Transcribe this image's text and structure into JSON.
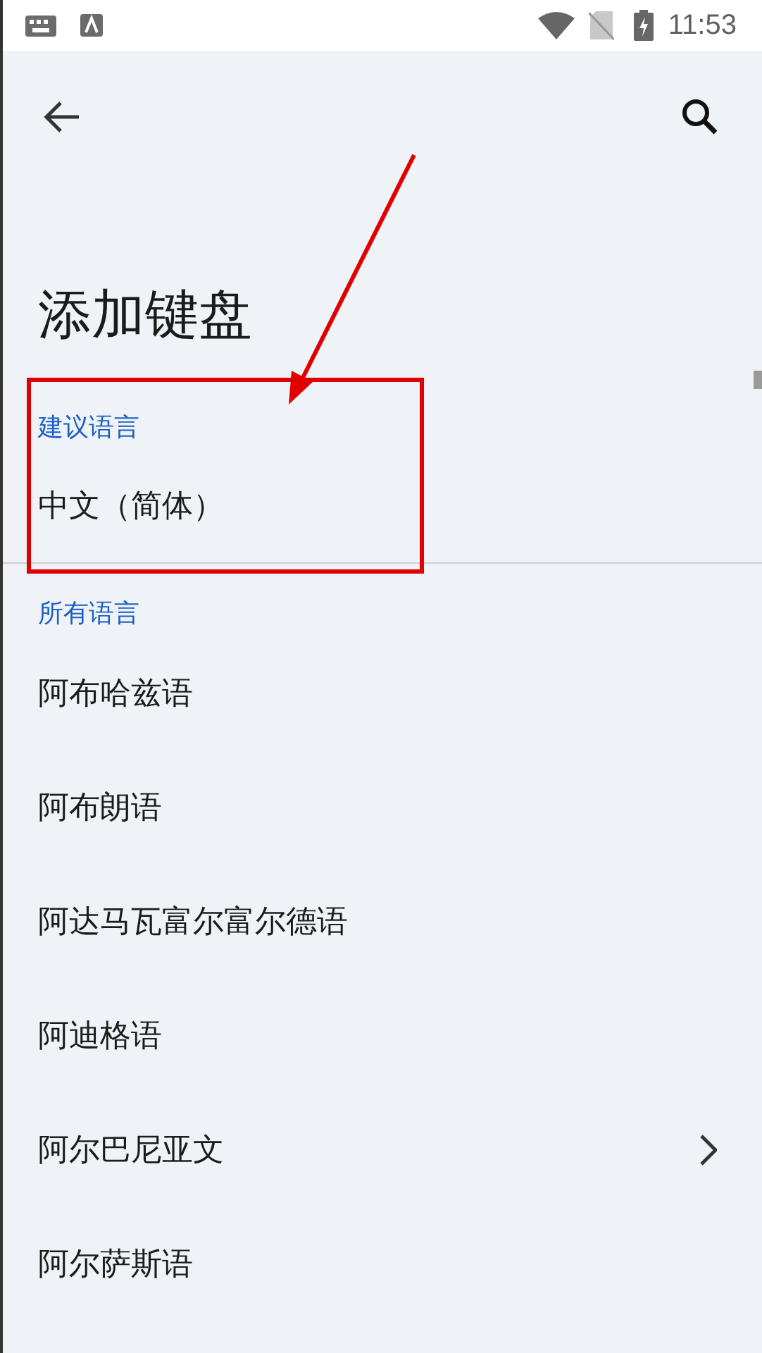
{
  "status_bar": {
    "time": "11:53"
  },
  "title": "添加键盘",
  "sections": [
    {
      "header": "建议语言",
      "items": [
        {
          "label": "中文（简体）",
          "kind": "plain"
        }
      ]
    },
    {
      "header": "所有语言",
      "items": [
        {
          "label": "阿布哈兹语",
          "kind": "plain"
        },
        {
          "label": "阿布朗语",
          "kind": "plain"
        },
        {
          "label": "阿达马瓦富尔富尔德语",
          "kind": "plain"
        },
        {
          "label": "阿迪格语",
          "kind": "plain"
        },
        {
          "label": "阿尔巴尼亚文",
          "kind": "submenu"
        },
        {
          "label": "阿尔萨斯语",
          "kind": "plain"
        }
      ]
    }
  ]
}
